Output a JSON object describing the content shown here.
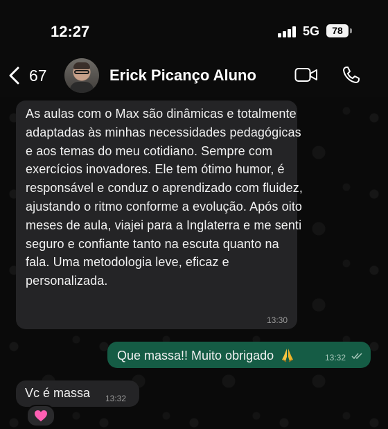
{
  "status_bar": {
    "time": "12:27",
    "network": "5G",
    "battery": "78"
  },
  "header": {
    "back_count": "67",
    "contact_name": "Erick Picanço Aluno",
    "icons": {
      "back": "chevron-left-icon",
      "video": "video-camera-icon",
      "call": "phone-icon"
    }
  },
  "messages": [
    {
      "direction": "incoming",
      "text": "As aulas com o Max são dinâmicas e totalmente adaptadas às minhas necessidades pedagógicas e aos temas do meu cotidiano. Sempre com exercícios inovadores. Ele tem ótimo humor, é responsável e conduz o aprendizado com fluidez, ajustando o ritmo conforme a evolução. Após oito meses de aula, viajei para a Inglaterra e me senti seguro e confiante tanto na escuta quanto na fala. Uma metodologia leve, eficaz e personalizada.",
      "time": "13:30"
    },
    {
      "direction": "outgoing",
      "text": "Que massa!! Muito obrigado",
      "emoji": "folded-hands",
      "time": "13:32",
      "status": "read"
    },
    {
      "direction": "incoming",
      "text": "Vc é massa",
      "time": "13:32",
      "reaction": "pink-heart"
    }
  ],
  "colors": {
    "incoming_bubble": "#242426",
    "outgoing_bubble": "#155c45",
    "background": "#0b0b0b"
  }
}
